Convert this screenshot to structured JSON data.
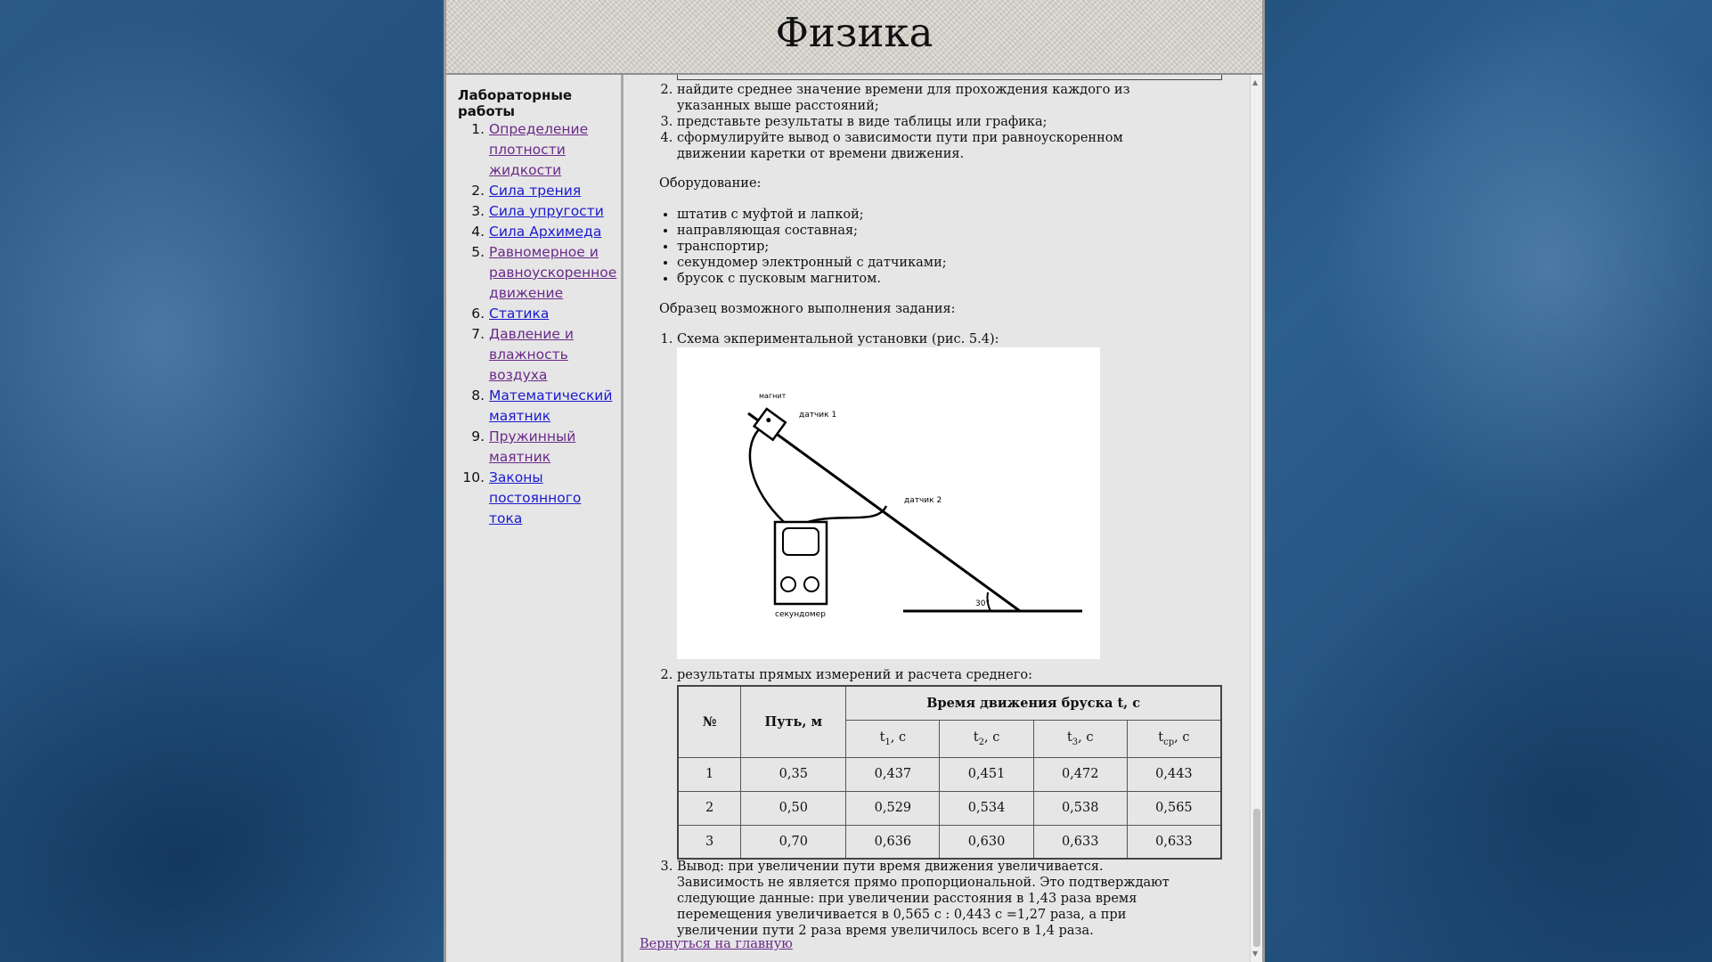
{
  "header": {
    "title": "Физика"
  },
  "sidebar": {
    "title": "Лабораторные работы",
    "items": [
      {
        "num": "1.",
        "label": "Определение плотности жидкости",
        "visited": true
      },
      {
        "num": "2.",
        "label": "Сила трения",
        "visited": false
      },
      {
        "num": "3.",
        "label": "Сила упругости",
        "visited": false
      },
      {
        "num": "4.",
        "label": "Сила Архимеда",
        "visited": false
      },
      {
        "num": "5.",
        "label": "Равномерное и равноускоренное движение",
        "visited": true
      },
      {
        "num": "6.",
        "label": "Статика",
        "visited": false
      },
      {
        "num": "7.",
        "label": "Давление и влажность воздуха",
        "visited": true
      },
      {
        "num": "8.",
        "label": "Математический маятник",
        "visited": false
      },
      {
        "num": "9.",
        "label": "Пружинный маятник",
        "visited": true
      },
      {
        "num": "10.",
        "label": "Законы постоянного тока",
        "visited": false
      }
    ]
  },
  "content": {
    "steps": [
      "найдите среднее значение времени для прохождения каждого из указанных выше расстояний;",
      "представьте результаты в виде таблицы или графика;",
      "сформулируйте вывод о зависимости пути при равноускоренном движении каретки от времени движения."
    ],
    "equipment_label": "Оборудование:",
    "equipment": [
      "штатив с муфтой и лапкой;",
      "направляющая составная;",
      "транспортир;",
      "секундомер электронный с датчиками;",
      "брусок с пусковым магнитом."
    ],
    "sample_label": "Образец возможного выполнения задания:",
    "sample_item_1": "Схема экпериментальной установки (рис. 5.4):",
    "figure": {
      "label_magnet": "магнит",
      "label_sensor1": "датчик 1",
      "label_sensor2": "датчик 2",
      "label_angle": "30°",
      "label_stopwatch": "секундомер"
    },
    "sample_item_2": "результаты прямых измерений и расчета среднего:",
    "table": {
      "col_num": "№",
      "col_path": "Путь, м",
      "col_time_group": "Время движения бруска t, с",
      "sub_t1": "t",
      "sub_t1_idx": "1",
      "sub_t2": "t",
      "sub_t2_idx": "2",
      "sub_t3": "t",
      "sub_t3_idx": "3",
      "sub_tavg": "t",
      "sub_tavg_idx": "ср",
      "unit": ", с",
      "rows": [
        [
          "1",
          "0,35",
          "0,437",
          "0,451",
          "0,472",
          "0,443"
        ],
        [
          "2",
          "0,50",
          "0,529",
          "0,534",
          "0,538",
          "0,565"
        ],
        [
          "3",
          "0,70",
          "0,636",
          "0,630",
          "0,633",
          "0,633"
        ]
      ]
    },
    "conclusion": "Вывод: при увеличении пути время движения увеличивается. Зависимость не является прямо пропорциональной. Это подтверждают следующие данные: при увеличении расстояния в 1,43 раза время перемещения увеличивается в 0,565 с : 0,443 с =1,27 раза, а при увеличении пути 2 раза время увеличилось всего в 1,4 раза.",
    "back_link": "Вернуться на главную"
  }
}
